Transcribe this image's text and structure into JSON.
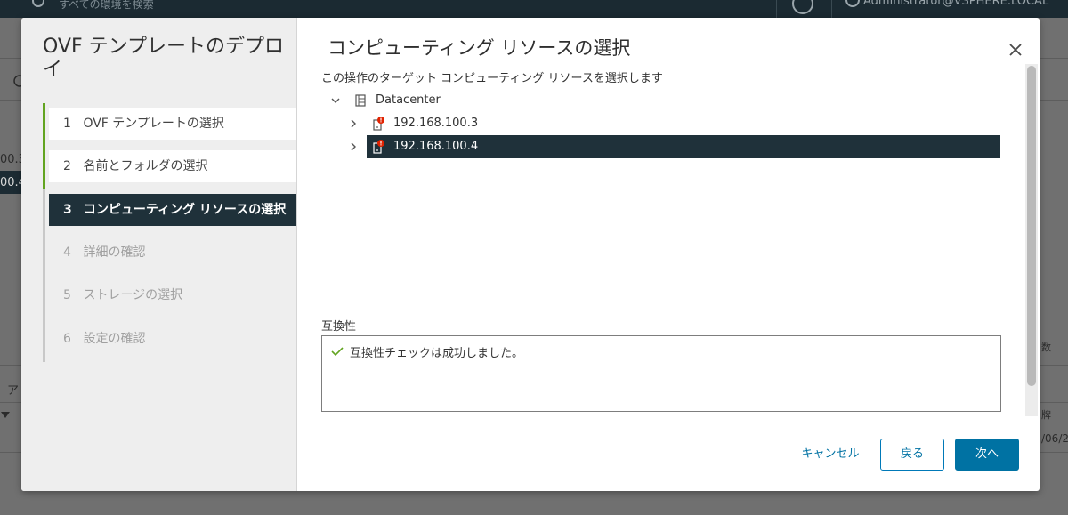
{
  "background": {
    "search_placeholder": "すべての環境を検索",
    "user_label": "Administrator@VSPHERE.LOCAL",
    "fragments": [
      "00.3",
      "00.4",
      "数",
      "ア",
      "牌",
      "/06/2",
      "--"
    ]
  },
  "wizard": {
    "title": "OVF テンプレートのデプロイ",
    "steps": [
      {
        "num": "1",
        "label": "OVF テンプレートの選択",
        "state": "done"
      },
      {
        "num": "2",
        "label": "名前とフォルダの選択",
        "state": "done"
      },
      {
        "num": "3",
        "label": "コンピューティング リソースの選択",
        "state": "active"
      },
      {
        "num": "4",
        "label": "詳細の確認",
        "state": "pending"
      },
      {
        "num": "5",
        "label": "ストレージの選択",
        "state": "pending"
      },
      {
        "num": "6",
        "label": "設定の確認",
        "state": "pending"
      }
    ]
  },
  "page": {
    "title": "コンピューティング リソースの選択",
    "subtitle": "この操作のターゲット コンピューティング リソースを選択します",
    "tree": {
      "root": {
        "label": "Datacenter",
        "expanded": true,
        "icon": "datacenter-icon"
      },
      "hosts": [
        {
          "label": "192.168.100.3",
          "selected": false,
          "icon": "host-warning-icon"
        },
        {
          "label": "192.168.100.4",
          "selected": true,
          "icon": "host-warning-icon"
        }
      ]
    },
    "compatibility": {
      "label": "互換性",
      "message": "互換性チェックは成功しました。",
      "status": "success"
    }
  },
  "footer": {
    "cancel_label": "キャンセル",
    "back_label": "戻る",
    "next_label": "次へ"
  },
  "colors": {
    "accent": "#0072a3",
    "active_step_bg": "#1f313a",
    "progress_green": "#62a420",
    "warning_red": "#e12200",
    "success_green": "#62a420"
  }
}
